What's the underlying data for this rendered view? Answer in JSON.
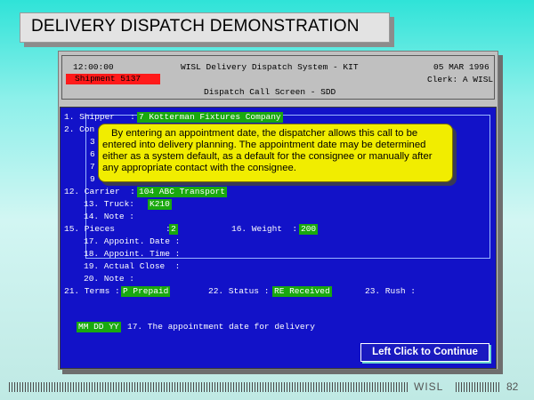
{
  "slide_title": "DELIVERY DISPATCH DEMONSTRATION",
  "header": {
    "time": "12:00:00",
    "system_name": "WISL Delivery Dispatch System - KIT",
    "date": "05 MAR 1996",
    "shipment": "Shipment 5137",
    "clerk": "Clerk: A WISL",
    "screen_name": "Dispatch Call Screen - SDD"
  },
  "form": {
    "shipper_label": "1. Shipper   :",
    "shipper_value": "7 Kotterman Fixtures Company",
    "consignee_label": "2. Con",
    "row3_label": "3",
    "row6_label": "6",
    "row7_label": "7",
    "row9_label": "9",
    "carrier_label": "12. Carrier  :",
    "carrier_value": "104 ABC Transport",
    "truck_label": "13. Truck:",
    "truck_value": "K210",
    "note14_label": "14. Note :",
    "pieces_label": "15. Pieces          :",
    "pieces_value": "2",
    "weight_label": "16. Weight  :",
    "weight_value": "200",
    "appoint_date_label": "17. Appoint. Date :",
    "appoint_time_label": "18. Appoint. Time :",
    "actual_close_label": "19. Actual Close  :",
    "note20_label": "20. Note :",
    "terms_label": "21. Terms :",
    "terms_value": "P Prepaid",
    "status_label": "22. Status :",
    "status_value": "RE Received",
    "rush_label": "23. Rush :",
    "prompt_field": "MM DD YY",
    "prompt_text": "17. The appointment date for delivery"
  },
  "tooltip_text": "By entering an appointment date, the dispatcher allows this call to be entered into delivery planning. The appointment date may be determined either as a system default, as a default for the consignee or manually after any appropriate contact with the consignee.",
  "continue_label": "Left Click to Continue",
  "footer_brand": "WISL",
  "page_number": "82",
  "colors": {
    "screen_bg": "#1212c8",
    "field_bg": "#19a80f",
    "tooltip_bg": "#f1ed00",
    "shipment_bar": "#ff1a1a"
  }
}
